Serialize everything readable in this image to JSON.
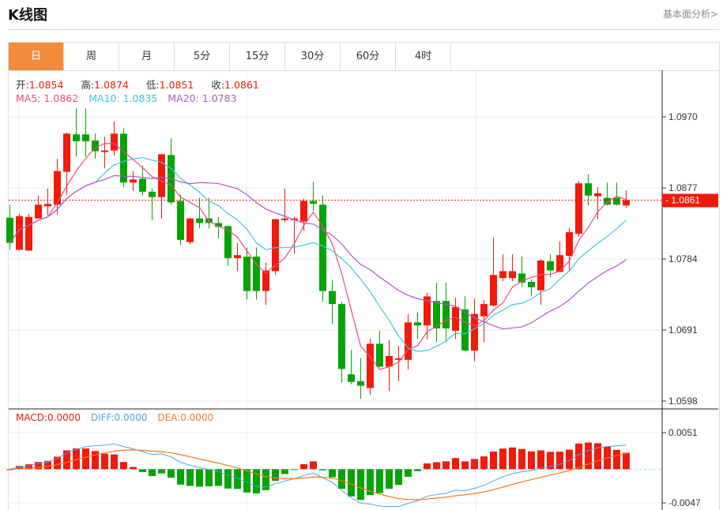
{
  "header": {
    "title": "K线图",
    "more_link": "基本面分析>"
  },
  "tabs": [
    {
      "label": "日",
      "active": true
    },
    {
      "label": "周"
    },
    {
      "label": "月"
    },
    {
      "label": "5分"
    },
    {
      "label": "15分"
    },
    {
      "label": "30分"
    },
    {
      "label": "60分"
    },
    {
      "label": "4时"
    }
  ],
  "ohlc_readout": {
    "open_label": "开:",
    "open": "1.0854",
    "high_label": "高:",
    "high": "1.0874",
    "low_label": "低:",
    "low": "1.0851",
    "close_label": "收:",
    "close": "1.0861"
  },
  "ma_readout": {
    "ma5": "MA5: 1.0862",
    "ma10": "MA10: 1.0835",
    "ma20": "MA20: 1.0783"
  },
  "macd_readout": {
    "macd": "MACD:0.0000",
    "diff": "DIFF:0.0000",
    "dea": "DEA:0.0000"
  },
  "colors": {
    "up": "#f21a0a",
    "down": "#05a305",
    "ma5": "#ee4b7c",
    "ma10": "#3cc6dc",
    "ma20": "#b455c8",
    "diff": "#4aa3e8",
    "dea": "#f57a1f",
    "accent": "#f28c3c"
  },
  "chart_data": {
    "type": "candlestick",
    "price_axis": {
      "ticks": [
        "1.0970",
        "1.0877",
        "1.0784",
        "1.0691",
        "1.0598"
      ],
      "range": [
        1.0598,
        1.097
      ]
    },
    "current_price_label": "- 1.0861",
    "current_price": 1.0861,
    "macd_axis": {
      "ticks": [
        "0.0051",
        "-0.0047"
      ],
      "range": [
        -0.0047,
        0.0051
      ]
    },
    "candles": [
      [
        1.0838,
        1.0855,
        1.0796,
        1.0805
      ],
      [
        1.0796,
        1.0843,
        1.0795,
        1.084
      ],
      [
        1.0795,
        1.0843,
        1.0795,
        1.0839
      ],
      [
        1.0837,
        1.0867,
        1.0837,
        1.0855
      ],
      [
        1.0853,
        1.0876,
        1.0841,
        1.0856
      ],
      [
        1.0855,
        1.0915,
        1.0842,
        1.0899
      ],
      [
        1.0898,
        1.0949,
        1.0868,
        1.0948
      ],
      [
        1.0947,
        1.0981,
        1.0918,
        1.0938
      ],
      [
        1.0947,
        1.0981,
        1.0918,
        1.0938
      ],
      [
        1.0939,
        1.0948,
        1.0915,
        1.0925
      ],
      [
        1.0924,
        1.0944,
        1.0903,
        1.0926
      ],
      [
        1.0926,
        1.0964,
        1.0919,
        1.0948
      ],
      [
        1.0948,
        1.0955,
        1.0878,
        1.0884
      ],
      [
        1.0884,
        1.0899,
        1.0873,
        1.0888
      ],
      [
        1.0889,
        1.0906,
        1.0867,
        1.0872
      ],
      [
        1.0872,
        1.0876,
        1.0835,
        1.0865
      ],
      [
        1.0865,
        1.0922,
        1.0837,
        1.0921
      ],
      [
        1.092,
        1.0942,
        1.0855,
        1.0858
      ],
      [
        1.086,
        1.0868,
        1.0802,
        1.0809
      ],
      [
        1.0806,
        1.0838,
        1.0803,
        1.0837
      ],
      [
        1.0837,
        1.0864,
        1.0824,
        1.0831
      ],
      [
        1.0837,
        1.0864,
        1.0824,
        1.0831
      ],
      [
        1.0831,
        1.0839,
        1.0811,
        1.0826
      ],
      [
        1.0827,
        1.0827,
        1.0775,
        1.0785
      ],
      [
        1.0785,
        1.0805,
        1.0768,
        1.0789
      ],
      [
        1.0787,
        1.0799,
        1.0731,
        1.0742
      ],
      [
        1.0787,
        1.0799,
        1.0731,
        1.0742
      ],
      [
        1.0742,
        1.0779,
        1.0724,
        1.0769
      ],
      [
        1.0768,
        1.0837,
        1.0763,
        1.0836
      ],
      [
        1.0835,
        1.0876,
        1.0832,
        1.0837
      ],
      [
        1.0835,
        1.0839,
        1.0791,
        1.0837
      ],
      [
        1.0833,
        1.0863,
        1.0821,
        1.086
      ],
      [
        1.086,
        1.0885,
        1.0847,
        1.0856
      ],
      [
        1.0855,
        1.0867,
        1.0728,
        1.0742
      ],
      [
        1.0742,
        1.0756,
        1.0699,
        1.0725
      ],
      [
        1.0725,
        1.0728,
        1.0622,
        1.064
      ],
      [
        1.0633,
        1.0665,
        1.062,
        1.0623
      ],
      [
        1.0624,
        1.0654,
        1.0601,
        1.0618
      ],
      [
        1.0615,
        1.068,
        1.0606,
        1.0673
      ],
      [
        1.0673,
        1.069,
        1.0642,
        1.0643
      ],
      [
        1.0643,
        1.0678,
        1.0611,
        1.0657
      ],
      [
        1.0652,
        1.067,
        1.0624,
        1.0654
      ],
      [
        1.0652,
        1.0712,
        1.0639,
        1.0701
      ],
      [
        1.0701,
        1.0714,
        1.0679,
        1.0697
      ],
      [
        1.0697,
        1.074,
        1.0679,
        1.0735
      ],
      [
        1.0729,
        1.0753,
        1.0675,
        1.0693
      ],
      [
        1.0729,
        1.0753,
        1.0675,
        1.0693
      ],
      [
        1.069,
        1.0733,
        1.0679,
        1.0721
      ],
      [
        1.0718,
        1.0735,
        1.0663,
        1.0664
      ],
      [
        1.0664,
        1.0732,
        1.065,
        1.0712
      ],
      [
        1.0709,
        1.073,
        1.0675,
        1.0725
      ],
      [
        1.0723,
        1.0812,
        1.0722,
        1.0763
      ],
      [
        1.0759,
        1.079,
        1.0755,
        1.0768
      ],
      [
        1.0759,
        1.079,
        1.0755,
        1.0768
      ],
      [
        1.0765,
        1.0787,
        1.0748,
        1.0753
      ],
      [
        1.0754,
        1.0757,
        1.0735,
        1.0747
      ],
      [
        1.0743,
        1.0784,
        1.0724,
        1.0782
      ],
      [
        1.0781,
        1.079,
        1.076,
        1.0769
      ],
      [
        1.0767,
        1.0807,
        1.0766,
        1.0789
      ],
      [
        1.0788,
        1.0825,
        1.0769,
        1.0819
      ],
      [
        1.0817,
        1.0886,
        1.0813,
        1.0883
      ],
      [
        1.0883,
        1.0895,
        1.0854,
        1.0867
      ],
      [
        1.0866,
        1.0878,
        1.0836,
        1.087
      ],
      [
        1.0864,
        1.0884,
        1.0854,
        1.0855
      ],
      [
        1.0864,
        1.0884,
        1.0854,
        1.0855
      ],
      [
        1.0854,
        1.0874,
        1.0851,
        1.0861
      ]
    ],
    "candle_fields": [
      "open",
      "high",
      "low",
      "close"
    ],
    "series": [
      "MA5",
      "MA10",
      "MA20",
      "MACD",
      "DIFF",
      "DEA"
    ]
  }
}
